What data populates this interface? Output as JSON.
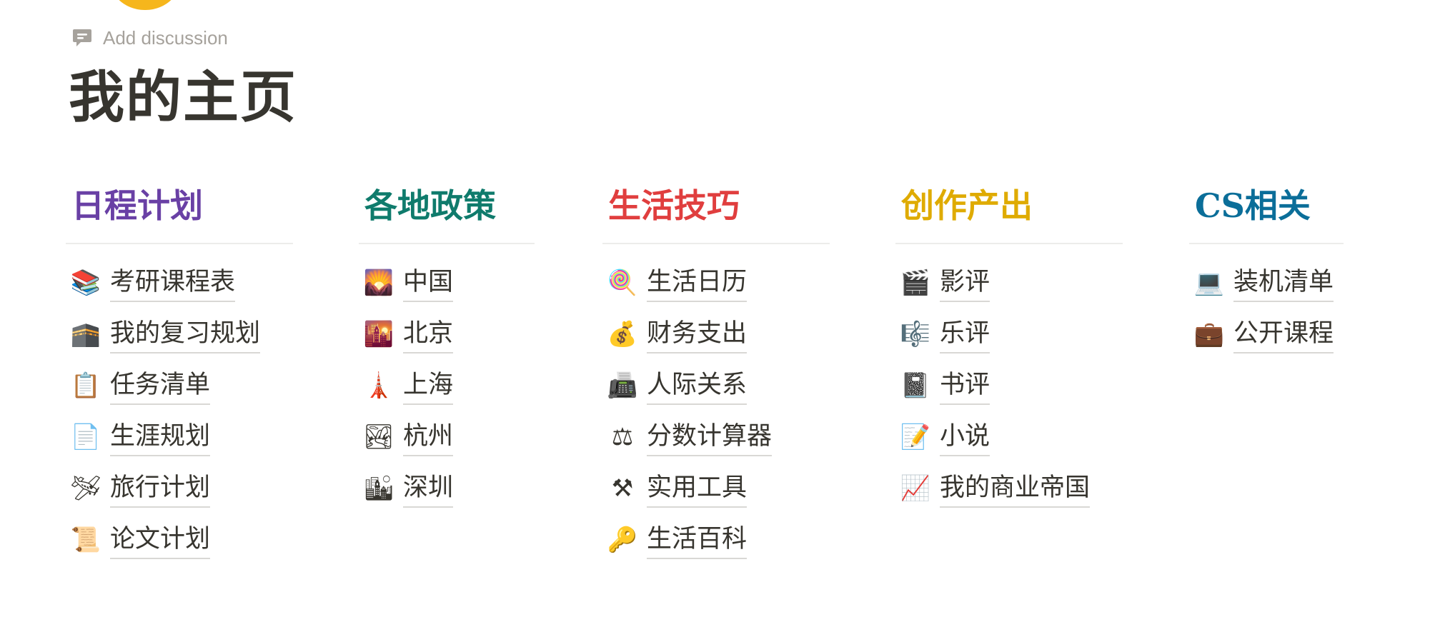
{
  "toolbar": {
    "add_discussion_label": "Add discussion"
  },
  "page": {
    "title": "我的主页"
  },
  "colors": {
    "schedule": "#6940a5",
    "policy": "#0f7b6c",
    "life": "#e03e3e",
    "creative": "#dfab01",
    "cs": "#0b6e99"
  },
  "columns": [
    {
      "heading": "日程计划",
      "items": [
        {
          "icon": "📚",
          "icon_name": "books-icon",
          "label": "考研课程表"
        },
        {
          "icon": "🕋",
          "icon_name": "kaaba-icon",
          "label": "我的复习规划"
        },
        {
          "icon": "📋",
          "icon_name": "clipboard-icon",
          "label": "任务清单"
        },
        {
          "icon": "📄",
          "icon_name": "document-icon",
          "label": "生涯规划"
        },
        {
          "icon": "🛩",
          "icon_name": "airplane-icon",
          "label": "旅行计划"
        },
        {
          "icon": "📜",
          "icon_name": "scroll-icon",
          "label": "论文计划"
        }
      ]
    },
    {
      "heading": "各地政策",
      "items": [
        {
          "icon": "🌄",
          "icon_name": "sunrise-mountains-icon",
          "label": "中国"
        },
        {
          "icon": "🌇",
          "icon_name": "city-sunset-icon",
          "label": "北京"
        },
        {
          "icon": "🗼",
          "icon_name": "tokyo-tower-icon",
          "label": "上海"
        },
        {
          "icon": "🏞",
          "icon_name": "national-park-icon",
          "label": "杭州"
        },
        {
          "icon": "🏙",
          "icon_name": "cityscape-icon",
          "label": "深圳"
        }
      ]
    },
    {
      "heading": "生活技巧",
      "items": [
        {
          "icon": "🍭",
          "icon_name": "lollipop-icon",
          "label": "生活日历"
        },
        {
          "icon": "💰",
          "icon_name": "money-bag-icon",
          "label": "财务支出"
        },
        {
          "icon": "📠",
          "icon_name": "fax-machine-icon",
          "label": "人际关系"
        },
        {
          "icon": "⚖",
          "icon_name": "balance-scale-icon",
          "label": "分数计算器"
        },
        {
          "icon": "⚒",
          "icon_name": "hammer-pick-icon",
          "label": "实用工具"
        },
        {
          "icon": "🔑",
          "icon_name": "key-icon",
          "label": "生活百科"
        }
      ]
    },
    {
      "heading": "创作产出",
      "items": [
        {
          "icon": "🎬",
          "icon_name": "clapper-board-icon",
          "label": "影评"
        },
        {
          "icon": "🎼",
          "icon_name": "musical-score-icon",
          "label": "乐评"
        },
        {
          "icon": "📓",
          "icon_name": "notebook-icon",
          "label": "书评"
        },
        {
          "icon": "📝",
          "icon_name": "memo-icon",
          "label": "小说"
        },
        {
          "icon": "📈",
          "icon_name": "chart-increasing-icon",
          "label": "我的商业帝国"
        }
      ]
    },
    {
      "heading": "CS相关",
      "items": [
        {
          "icon": "💻",
          "icon_name": "laptop-icon",
          "label": "装机清单"
        },
        {
          "icon": "💼",
          "icon_name": "briefcase-icon",
          "label": "公开课程"
        }
      ]
    }
  ]
}
